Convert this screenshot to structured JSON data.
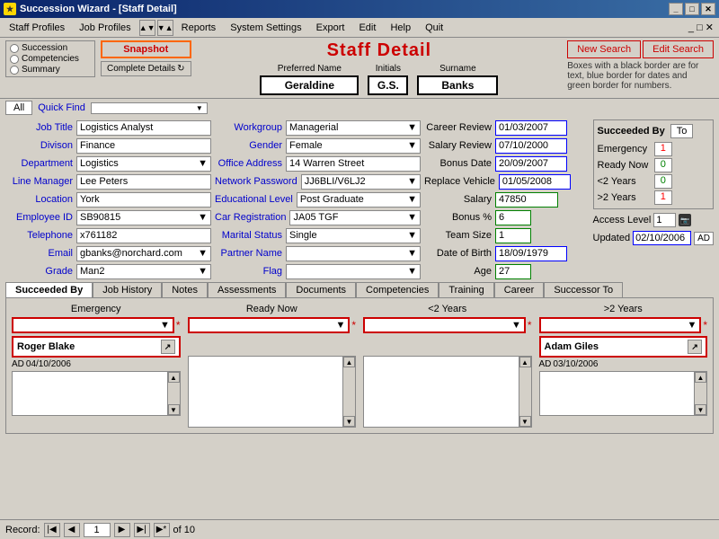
{
  "titleBar": {
    "title": "Succession Wizard - [Staff Detail]",
    "icon": "★"
  },
  "menuBar": {
    "items": [
      "Staff Profiles",
      "Job Profiles",
      "Reports",
      "System Settings",
      "Export",
      "Edit",
      "Help",
      "Quit"
    ]
  },
  "toolbar": {
    "radioOptions": [
      "Succession",
      "Competencies",
      "Summary"
    ],
    "snapshotLabel": "Snapshot",
    "completeDetailsLabel": "Complete Details",
    "pageTitle": "Staff Detail",
    "newSearchLabel": "New Search",
    "editSearchLabel": "Edit Search",
    "hintText": "Boxes with a black border are for text, blue border for dates and green border for numbers."
  },
  "nameRow": {
    "preferredNameLabel": "Preferred Name",
    "initialsLabel": "Initials",
    "surnameLabel": "Surname",
    "preferredName": "Geraldine",
    "initials": "G.S.",
    "surname": "Banks"
  },
  "quickFind": {
    "allLabel": "All",
    "label": "Quick Find",
    "value": ""
  },
  "formFields": {
    "col1": [
      {
        "label": "Job Title",
        "value": "Logistics Analyst",
        "type": "text"
      },
      {
        "label": "Division",
        "value": "Finance",
        "type": "text"
      },
      {
        "label": "Department",
        "value": "Logistics",
        "type": "combo"
      },
      {
        "label": "Line Manager",
        "value": "Lee Peters",
        "type": "text"
      },
      {
        "label": "Location",
        "value": "York",
        "type": "text"
      },
      {
        "label": "Employee ID",
        "value": "SB90815",
        "type": "combo"
      },
      {
        "label": "Telephone",
        "value": "x761182",
        "type": "text"
      },
      {
        "label": "Email",
        "value": "gbanks@norchard.com",
        "type": "combo"
      },
      {
        "label": "Grade",
        "value": "Man2",
        "type": "combo"
      }
    ],
    "col2": [
      {
        "label": "Workgroup",
        "value": "Managerial",
        "type": "combo"
      },
      {
        "label": "Gender",
        "value": "Female",
        "type": "combo"
      },
      {
        "label": "Office Address",
        "value": "14 Warren Street",
        "type": "text"
      },
      {
        "label": "Network Password",
        "value": "JJ6BLI/V6LJ2",
        "type": "combo"
      },
      {
        "label": "Educational Level",
        "value": "Post Graduate",
        "type": "combo"
      },
      {
        "label": "Car Registration",
        "value": "JA05 TGF",
        "type": "combo"
      },
      {
        "label": "Marital Status",
        "value": "Single",
        "type": "combo"
      },
      {
        "label": "Partner Name",
        "value": "",
        "type": "combo"
      },
      {
        "label": "Flag",
        "value": "",
        "type": "combo"
      }
    ],
    "col3": [
      {
        "label": "Career Review",
        "value": "01/03/2007",
        "type": "date"
      },
      {
        "label": "Salary Review",
        "value": "07/10/2000",
        "type": "date"
      },
      {
        "label": "Bonus Date",
        "value": "20/09/2007",
        "type": "date"
      },
      {
        "label": "Replace Vehicle",
        "value": "01/05/2008",
        "type": "date"
      },
      {
        "label": "Salary",
        "value": "47850",
        "type": "number"
      },
      {
        "label": "Bonus %",
        "value": "6",
        "type": "number"
      },
      {
        "label": "Team Size",
        "value": "1",
        "type": "number"
      },
      {
        "label": "Date of Birth",
        "value": "18/09/1979",
        "type": "date"
      },
      {
        "label": "Age",
        "value": "27",
        "type": "number"
      }
    ]
  },
  "succeededBy": {
    "label": "Succeeded By",
    "toLabel": "To",
    "rows": [
      {
        "label": "Emergency",
        "value": "1",
        "color": "red"
      },
      {
        "label": "Ready Now",
        "value": "0",
        "color": "green"
      },
      {
        "label": "<2 Years",
        "value": "0",
        "color": "green"
      },
      {
        ">2 Years": ">2 Years",
        "label": ">2 Years",
        "value": "1",
        "color": "red"
      }
    ]
  },
  "accessLevel": {
    "label": "Access Level",
    "value": "1",
    "updatedLabel": "Updated",
    "updatedValue": "02/10/2006",
    "adLabel": "AD"
  },
  "tabs": {
    "items": [
      "Succeeded By",
      "Job History",
      "Notes",
      "Assessments",
      "Documents",
      "Competencies",
      "Training",
      "Career",
      "Successor To"
    ],
    "activeTab": "Succeeded By"
  },
  "succColumns": {
    "col1": {
      "title": "Emergency",
      "person": "Roger Blake",
      "adLabel": "AD",
      "date": "04/10/2006"
    },
    "col2": {
      "title": "Ready Now",
      "person": "",
      "adLabel": "",
      "date": ""
    },
    "col3": {
      "title": "<2 Years",
      "person": "",
      "adLabel": "",
      "date": ""
    },
    "col4": {
      "title": ">2 Years",
      "person": "Adam Giles",
      "adLabel": "AD",
      "date": "03/10/2006"
    }
  },
  "recordBar": {
    "recordLabel": "Record:",
    "currentRecord": "1",
    "totalLabel": "of 10"
  }
}
